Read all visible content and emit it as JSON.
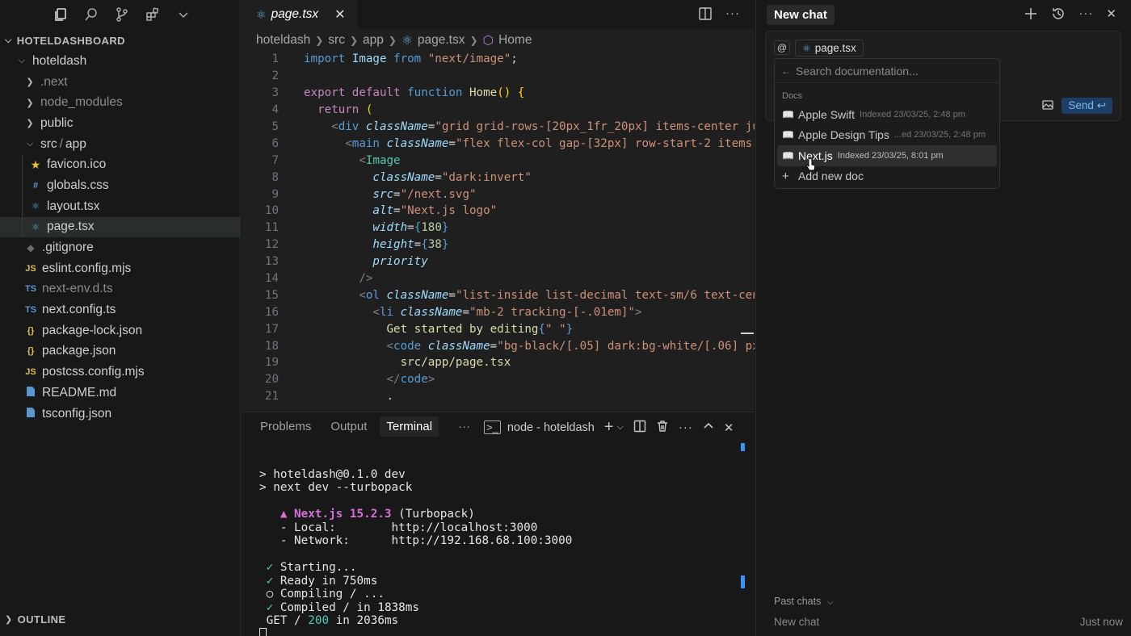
{
  "sidebar": {
    "section_title": "HOTELDASHBOARD",
    "outline_title": "OUTLINE",
    "items": [
      {
        "label": "hoteldash",
        "type": "folder-open",
        "indent": 1
      },
      {
        "label": ".next",
        "type": "folder",
        "indent": 2
      },
      {
        "label": "node_modules",
        "type": "folder",
        "indent": 2
      },
      {
        "label": "public",
        "type": "folder",
        "indent": 2
      },
      {
        "label": "src",
        "sep": "/",
        "label2": "app",
        "type": "folder-open",
        "indent": 2
      },
      {
        "label": "favicon.ico",
        "type": "ico",
        "indent": 3
      },
      {
        "label": "globals.css",
        "type": "css",
        "indent": 3
      },
      {
        "label": "layout.tsx",
        "type": "tsx",
        "indent": 3
      },
      {
        "label": "page.tsx",
        "type": "tsx",
        "indent": 3
      },
      {
        "label": ".gitignore",
        "type": "git",
        "indent": 2
      },
      {
        "label": "eslint.config.mjs",
        "type": "js",
        "indent": 2
      },
      {
        "label": "next-env.d.ts",
        "type": "ts",
        "indent": 2
      },
      {
        "label": "next.config.ts",
        "type": "ts",
        "indent": 2
      },
      {
        "label": "package-lock.json",
        "type": "json",
        "indent": 2
      },
      {
        "label": "package.json",
        "type": "json",
        "indent": 2
      },
      {
        "label": "postcss.config.mjs",
        "type": "js",
        "indent": 2
      },
      {
        "label": "README.md",
        "type": "md",
        "indent": 2
      },
      {
        "label": "tsconfig.json",
        "type": "tsconfig",
        "indent": 2
      }
    ],
    "icon_text": {
      "js": "JS",
      "ts": "TS",
      "json": "{}",
      "css": "#"
    }
  },
  "editor": {
    "tab_label": "page.tsx",
    "breadcrumb": [
      "hoteldash",
      "src",
      "app",
      "page.tsx",
      "Home"
    ],
    "lines": [
      [
        [
          "k",
          "import "
        ],
        [
          "var",
          "Image "
        ],
        [
          "k",
          "from "
        ],
        [
          "s",
          "\"next/image\""
        ],
        [
          "txt",
          ";"
        ]
      ],
      [],
      [
        [
          "kw",
          "export "
        ],
        [
          "kw",
          "default "
        ],
        [
          "k",
          "function "
        ],
        [
          "fn",
          "Home"
        ],
        [
          "br",
          "() {"
        ]
      ],
      [
        [
          "txt",
          "  "
        ],
        [
          "kw",
          "return "
        ],
        [
          "br",
          "("
        ]
      ],
      [
        [
          "txt",
          "    "
        ],
        [
          "punc",
          "<"
        ],
        [
          "tag",
          "div "
        ],
        [
          "attr",
          "className"
        ],
        [
          "txt",
          "="
        ],
        [
          "s",
          "\"grid grid-rows-[20px_1fr_20px] items-center ju"
        ]
      ],
      [
        [
          "txt",
          "      "
        ],
        [
          "punc",
          "<"
        ],
        [
          "tag",
          "main "
        ],
        [
          "attr",
          "className"
        ],
        [
          "txt",
          "="
        ],
        [
          "s",
          "\"flex flex-col gap-[32px] row-start-2 items-"
        ]
      ],
      [
        [
          "txt",
          "        "
        ],
        [
          "punc",
          "<"
        ],
        [
          "tagn",
          "Image"
        ]
      ],
      [
        [
          "txt",
          "          "
        ],
        [
          "attr",
          "className"
        ],
        [
          "txt",
          "="
        ],
        [
          "s",
          "\"dark:invert\""
        ]
      ],
      [
        [
          "txt",
          "          "
        ],
        [
          "attr",
          "src"
        ],
        [
          "txt",
          "="
        ],
        [
          "s",
          "\"/next.svg\""
        ]
      ],
      [
        [
          "txt",
          "          "
        ],
        [
          "attr",
          "alt"
        ],
        [
          "txt",
          "="
        ],
        [
          "s",
          "\"Next.js logo\""
        ]
      ],
      [
        [
          "txt",
          "          "
        ],
        [
          "attr",
          "width"
        ],
        [
          "txt",
          "="
        ],
        [
          "k",
          "{"
        ],
        [
          "num",
          "180"
        ],
        [
          "k",
          "}"
        ]
      ],
      [
        [
          "txt",
          "          "
        ],
        [
          "attr",
          "height"
        ],
        [
          "txt",
          "="
        ],
        [
          "k",
          "{"
        ],
        [
          "num",
          "38"
        ],
        [
          "k",
          "}"
        ]
      ],
      [
        [
          "txt",
          "          "
        ],
        [
          "attr",
          "priority"
        ]
      ],
      [
        [
          "txt",
          "        "
        ],
        [
          "punc",
          "/>"
        ]
      ],
      [
        [
          "txt",
          "        "
        ],
        [
          "punc",
          "<"
        ],
        [
          "tag",
          "ol "
        ],
        [
          "attr",
          "className"
        ],
        [
          "txt",
          "="
        ],
        [
          "s",
          "\"list-inside list-decimal text-sm/6 text-cent"
        ]
      ],
      [
        [
          "txt",
          "          "
        ],
        [
          "punc",
          "<"
        ],
        [
          "tag",
          "li "
        ],
        [
          "attr",
          "className"
        ],
        [
          "txt",
          "="
        ],
        [
          "s",
          "\"mb-2 tracking-[-.01em]\""
        ],
        [
          "punc",
          ">"
        ]
      ],
      [
        [
          "txt",
          "            "
        ],
        [
          "fn",
          "Get started by editing"
        ],
        [
          "k",
          "{"
        ],
        [
          "s",
          "\" \""
        ],
        [
          "k",
          "}"
        ]
      ],
      [
        [
          "txt",
          "            "
        ],
        [
          "punc",
          "<"
        ],
        [
          "tag",
          "code "
        ],
        [
          "attr",
          "className"
        ],
        [
          "txt",
          "="
        ],
        [
          "s",
          "\"bg-black/[.05] dark:bg-white/[.06] px-"
        ]
      ],
      [
        [
          "txt",
          "              "
        ],
        [
          "fn",
          "src/app/page.tsx"
        ]
      ],
      [
        [
          "txt",
          "            "
        ],
        [
          "punc",
          "</"
        ],
        [
          "tag",
          "code"
        ],
        [
          "punc",
          ">"
        ]
      ],
      [
        [
          "txt",
          "            "
        ],
        [
          "fn",
          "."
        ]
      ]
    ]
  },
  "panel": {
    "tabs": [
      "Problems",
      "Output",
      "Terminal"
    ],
    "active_tab": "Terminal",
    "terminal_name": "node - hoteldash",
    "more": "···",
    "terminal_lines": [
      [
        [
          "n",
          ""
        ]
      ],
      [
        [
          "n",
          "> hoteldash@0.1.0 dev"
        ]
      ],
      [
        [
          "n",
          "> next dev --turbopack"
        ]
      ],
      [
        [
          "n",
          ""
        ]
      ],
      [
        [
          "m",
          "   ▲ Next.js 15.2.3"
        ],
        [
          "n",
          " (Turbopack)"
        ]
      ],
      [
        [
          "n",
          "   - Local:        http://localhost:3000"
        ]
      ],
      [
        [
          "n",
          "   - Network:      http://192.168.68.100:3000"
        ]
      ],
      [
        [
          "n",
          ""
        ]
      ],
      [
        [
          "g",
          " ✓"
        ],
        [
          "n",
          " Starting..."
        ]
      ],
      [
        [
          "g",
          " ✓"
        ],
        [
          "n",
          " Ready in 750ms"
        ]
      ],
      [
        [
          "n",
          " ○ Compiling / ..."
        ]
      ],
      [
        [
          "g",
          " ✓"
        ],
        [
          "n",
          " Compiled / in 1838ms"
        ]
      ],
      [
        [
          "n",
          " GET / "
        ],
        [
          "g",
          "200"
        ],
        [
          "n",
          " in 2036ms"
        ]
      ]
    ]
  },
  "chat": {
    "title": "New chat",
    "at_symbol": "@",
    "file_chip": "page.tsx",
    "send_label": "Send",
    "send_key": "↩",
    "doc_search_placeholder": "Search documentation...",
    "docs_section": "Docs",
    "docs": [
      {
        "name": "Apple Swift",
        "meta": "Indexed 23/03/25, 2:48 pm"
      },
      {
        "name": "Apple Design Tips",
        "meta": "...ed 23/03/25, 2:48 pm"
      },
      {
        "name": "Next.js",
        "meta": "Indexed 23/03/25, 8:01 pm"
      }
    ],
    "add_doc": "Add new doc",
    "past_chats_label": "Past chats",
    "past_chat_title": "New chat",
    "past_chat_time": "Just now"
  },
  "colors": {
    "accent": "#3794ff",
    "background": "#181818",
    "editor_background": "#1f1f1f"
  }
}
